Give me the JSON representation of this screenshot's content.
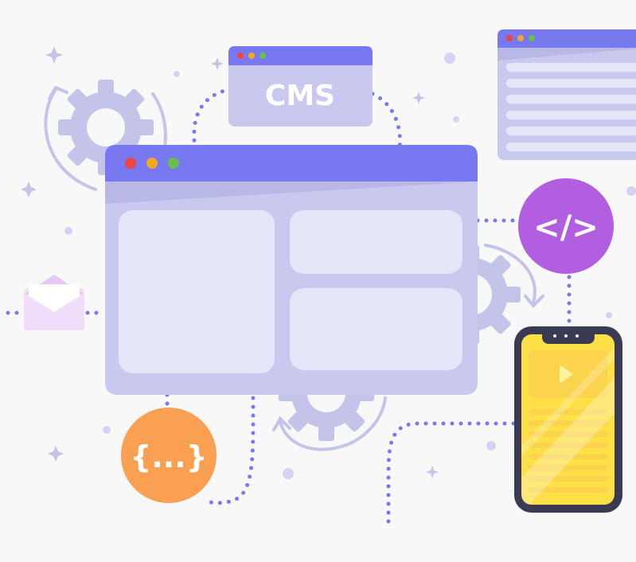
{
  "cms_window": {
    "label": "CMS"
  },
  "code_badge": {
    "label": "</>"
  },
  "json_badge": {
    "label": "{...}"
  },
  "colors": {
    "background": "#f8f8f8",
    "window_header": "#7879f1",
    "window_body": "#c9c9ef",
    "panel": "#e6e6fb",
    "dot_red": "#ef4444",
    "dot_yellow": "#f5a623",
    "dot_green": "#6abf4b",
    "gear": "#c4c4ea",
    "connector": "#7879f1",
    "code_badge": "#b25ee0",
    "json_badge": "#f9a052",
    "phone_body": "#3a3a52",
    "phone_screen": "#fde047",
    "envelope": "#f0dcfb"
  },
  "icons": [
    "gear-icon",
    "refresh-arrow-icon",
    "envelope-icon",
    "play-icon",
    "sparkle-icon",
    "code-icon",
    "json-braces-icon"
  ]
}
